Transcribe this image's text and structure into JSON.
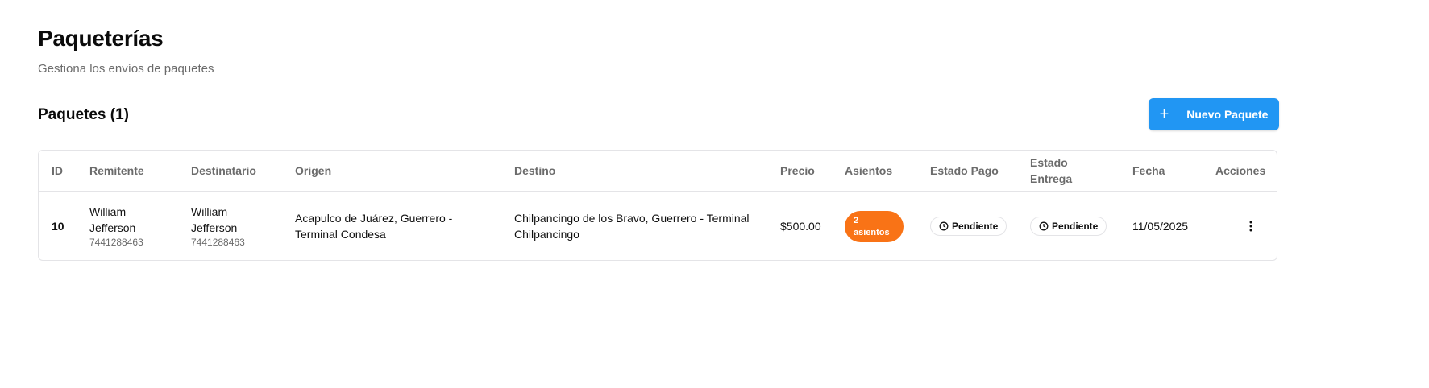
{
  "header": {
    "title": "Paqueterías",
    "subtitle": "Gestiona los envíos de paquetes"
  },
  "section": {
    "title": "Paquetes (1)",
    "new_button_label": "Nuevo Paquete",
    "new_button_icon": "plus-icon"
  },
  "colors": {
    "primary": "#2196f3",
    "seat_badge": "#f97316",
    "border": "#e4e4e7",
    "muted_text": "#6b6b6b"
  },
  "table": {
    "columns": {
      "id": "ID",
      "sender": "Remitente",
      "recipient": "Destinatario",
      "origin": "Origen",
      "destination": "Destino",
      "price": "Precio",
      "seats": "Asientos",
      "payment_status_1": "Estado Pago",
      "delivery_status_1": "Estado",
      "delivery_status_2": "Entrega",
      "date": "Fecha",
      "actions": "Acciones"
    },
    "rows": [
      {
        "id": "10",
        "sender_name_1": "William",
        "sender_name_2": "Jefferson",
        "sender_phone": "7441288463",
        "recipient_name_1": "William",
        "recipient_name_2": "Jefferson",
        "recipient_phone": "7441288463",
        "origin_1": "Acapulco de Juárez, Guerrero -",
        "origin_2": "Terminal Condesa",
        "destination_1": "Chilpancingo de los Bravo, Guerrero - Terminal",
        "destination_2": "Chilpancingo",
        "price": "$500.00",
        "seats_1": "2",
        "seats_2": "asientos",
        "payment_status": "Pendiente",
        "payment_icon": "clock-icon",
        "delivery_status": "Pendiente",
        "delivery_icon": "clock-icon",
        "date": "11/05/2025",
        "actions_icon": "more-vertical-icon"
      }
    ]
  }
}
